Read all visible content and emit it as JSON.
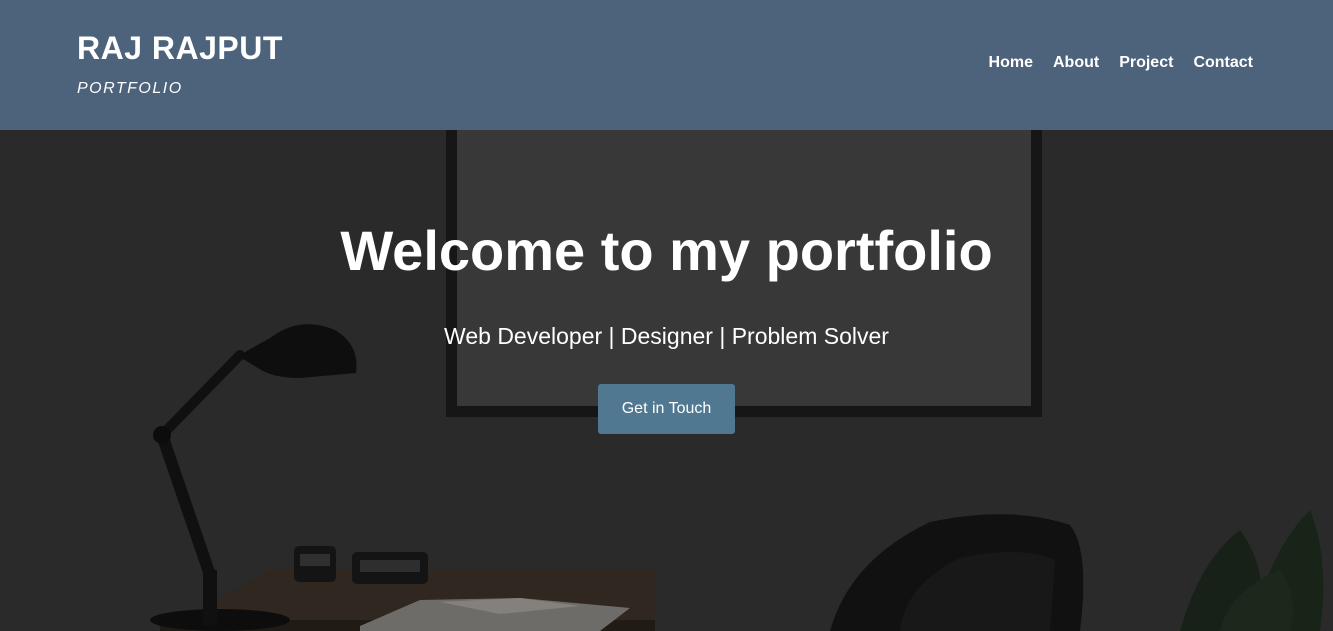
{
  "header": {
    "brand_name": "RAJ RAJPUT",
    "brand_subtitle": "PORTFOLIO",
    "nav": [
      {
        "label": "Home"
      },
      {
        "label": "About"
      },
      {
        "label": "Project"
      },
      {
        "label": "Contact"
      }
    ]
  },
  "hero": {
    "title": "Welcome to my portfolio",
    "subtitle": "Web Developer | Designer | Problem Solver",
    "cta_label": "Get in Touch"
  },
  "colors": {
    "header_bg": "#4d627b",
    "cta_bg": "#507891",
    "text": "#ffffff"
  }
}
